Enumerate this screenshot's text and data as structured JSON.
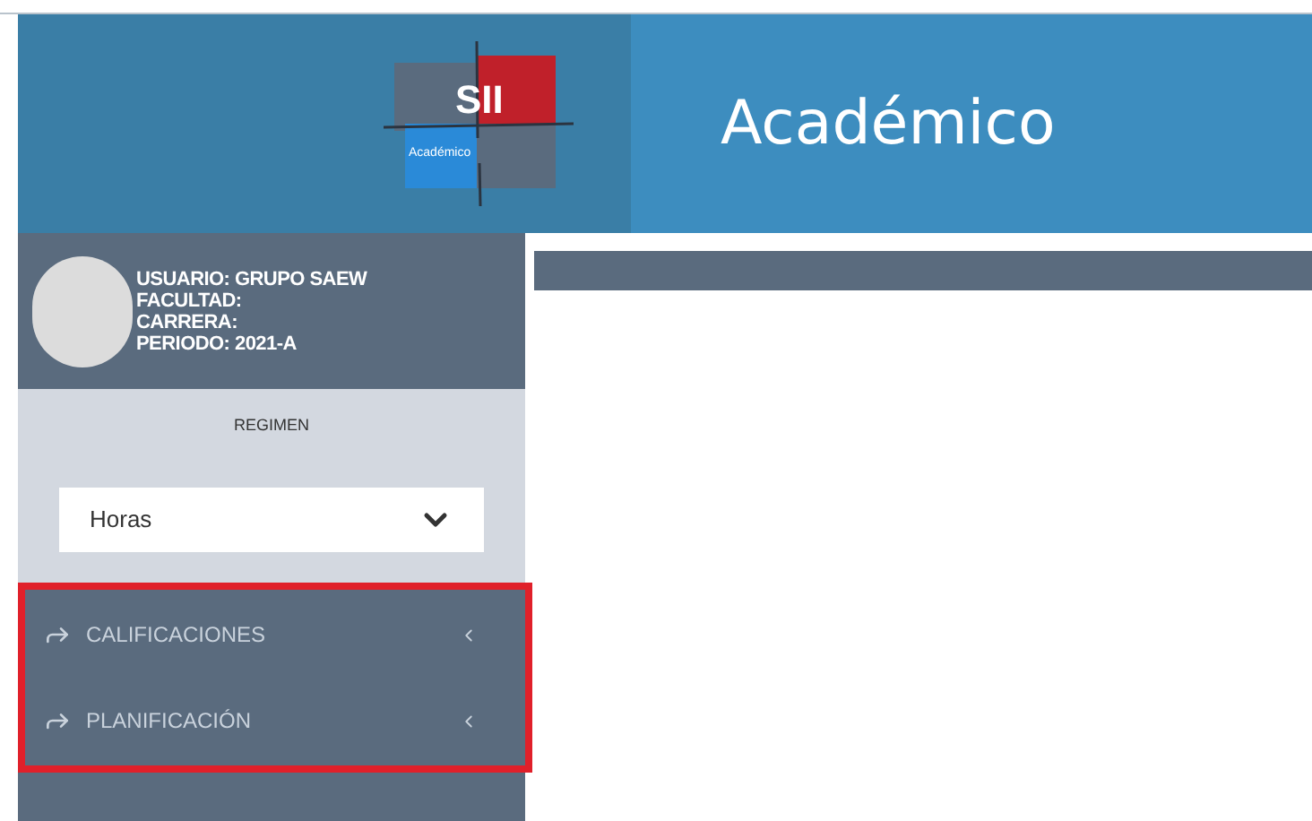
{
  "header": {
    "logo": {
      "mark": "SII",
      "subtitle": "Académico"
    },
    "title": "Académico"
  },
  "profile": {
    "lines": [
      {
        "label": "USUARIO:",
        "value": "GRUPO SAEW"
      },
      {
        "label": "FACULTAD:"
      },
      {
        "label": "CARRERA:"
      },
      {
        "label": "PERIODO:",
        "value": "2021-A"
      }
    ]
  },
  "regimen": {
    "label": "REGIMEN",
    "select_value": "Horas"
  },
  "menu": {
    "highlighted": true,
    "items": [
      {
        "label": "CALIFICACIONES"
      },
      {
        "label": "PLANIFICACIÓN"
      }
    ]
  }
}
